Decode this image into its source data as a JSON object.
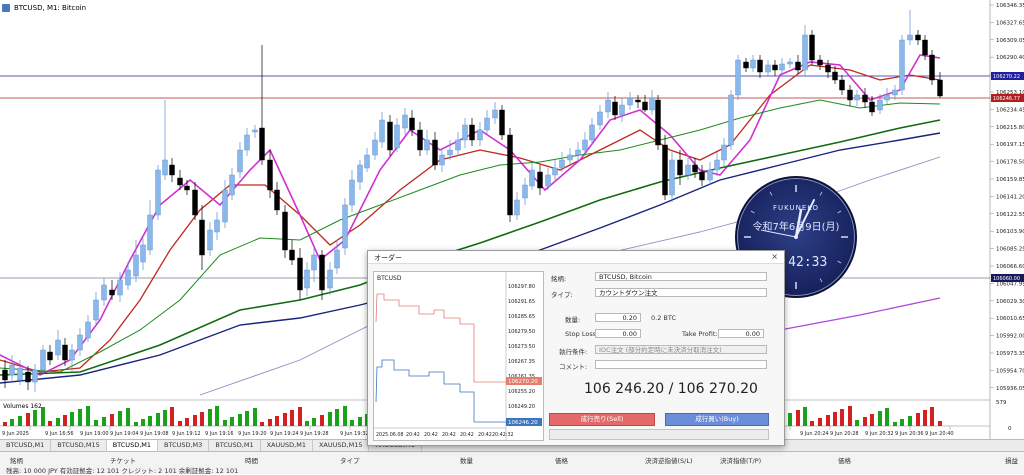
{
  "window": {
    "title": "BTCUSD, M1: Bitcoin"
  },
  "chart": {
    "price_labels": [
      "106346.35",
      "106327.65",
      "106309.05",
      "106290.40",
      "106271.75",
      "106253.10",
      "106234.45",
      "106215.80",
      "106197.15",
      "106178.50",
      "106159.85",
      "106141.20",
      "106122.55",
      "106103.90",
      "106085.25",
      "106066.60",
      "106047.95",
      "106029.30",
      "106010.65",
      "105992.00",
      "105973.35",
      "105954.70",
      "105936.05"
    ],
    "price_box_blue": "106270.22",
    "price_box_red": "106246.77",
    "price_box_grey": "106060.00",
    "volume_label": "Volumes 162",
    "volume_right": "579",
    "volume_zero": "0",
    "time_labels": [
      "9 Jun 2025",
      "9 Jun 16:56",
      "9 Jun 19:00",
      "9 Jun 19:04",
      "9 Jun 19:08",
      "9 Jun 19:12",
      "9 Jun 19:16",
      "9 Jun 19:20",
      "9 Jun 19:24",
      "9 Jun 19:28",
      "9 Jun 19:32",
      "9 Jun 20:24",
      "9 Jun 20:28",
      "9 Jun 20:32",
      "9 Jun 20:36",
      "9 Jun 20:40"
    ],
    "colors": {
      "bull": "#8ab8ea",
      "bear": "#000000",
      "ma_magenta": "#d12fd1",
      "ma_red": "#c1271b",
      "ma_green": "#1d8a1d",
      "ma_darkgreen": "#116b11",
      "ma_navy": "#1a237e",
      "ma_lavender": "#8c8cc8",
      "ma_purple": "#b04ad6",
      "hline_blue": "#2020a0",
      "hline_red": "#b02020"
    }
  },
  "tabs": [
    "BTCUSD,M1",
    "BTCUSD,M15",
    "BTCUSD,M1",
    "BTCUSD,M3",
    "BTCUSD,M1",
    "XAUUSD,M1",
    "XAUUSD,M15",
    "XAUUSD,M1"
  ],
  "bottom": {
    "headers": [
      "銘柄",
      "チケット",
      "時間",
      "タイプ",
      "数量",
      "価格",
      "決済逆指値(S/L)",
      "決済指値(T/P)",
      "価格",
      "損益"
    ],
    "status": "残高: 10 000 JPY  有効証拠金: 12 101  クレジット: 2 101  余剰証拠金: 12 101"
  },
  "clock": {
    "brand": "FUKUNEKO",
    "date": "令和7年6月9日(月)",
    "time": "02:42:33"
  },
  "dialog": {
    "title": "オーダー",
    "close": "×",
    "mini_title": "BTCUSD",
    "mini_prices": [
      "106297.80",
      "106291.65",
      "106285.65",
      "106279.50",
      "106273.50",
      "106267.35",
      "106261.35",
      "106255.20",
      "106249.20",
      "106243.05"
    ],
    "mini_box_red": "106270.20",
    "mini_box_blue": "106246.20",
    "mini_times": [
      "2025.06.08",
      "20:42",
      "20:42",
      "20:42",
      "20:42",
      "20:42",
      "20:42:32"
    ],
    "symbol_label": "銘柄:",
    "symbol_value": "BTCUSD, Bitcoin",
    "type_label": "タイプ:",
    "type_value": "カウントダウン注文",
    "volume_label": "数量:",
    "volume_value": "0.20",
    "volume_unit": "0.2 BTC",
    "sl_label": "Stop Loss:",
    "sl_value": "0.00",
    "tp_label": "Take Profit:",
    "tp_value": "0.00",
    "exec_label": "執行条件:",
    "exec_value": "IOC注文 (部分約定時に未決済分取消注文)",
    "comment_label": "コメント:",
    "comment_value": "",
    "price": "106 246.20 / 106 270.20",
    "sell": "成行売り(Sell)",
    "buy": "成行買い(Buy)"
  }
}
